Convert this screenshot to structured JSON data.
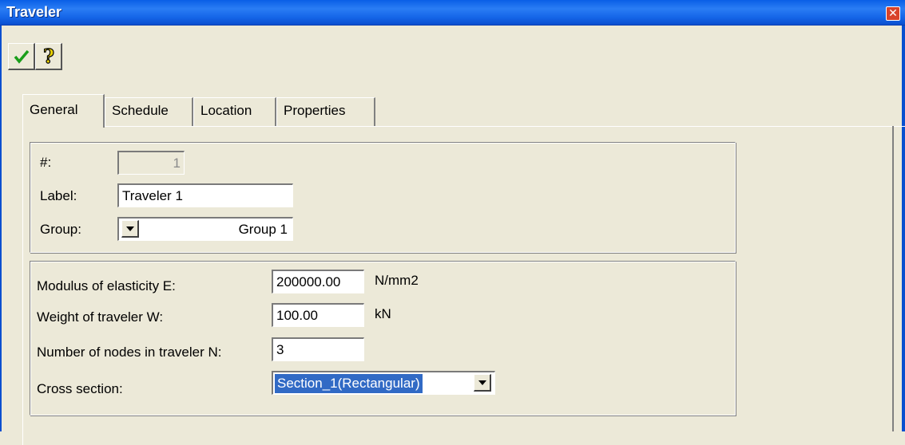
{
  "window": {
    "title": "Traveler"
  },
  "icons": {
    "close": "close-icon",
    "ok": "checkmark-icon",
    "help": "help-icon",
    "dropdown": "chevron-down-icon"
  },
  "tabs": [
    {
      "label": "General",
      "active": true
    },
    {
      "label": "Schedule",
      "active": false
    },
    {
      "label": "Location",
      "active": false
    },
    {
      "label": "Properties",
      "active": false
    }
  ],
  "general": {
    "number_label": "#:",
    "number_value": "1",
    "label_label": "Label:",
    "label_value": "Traveler 1",
    "group_label": "Group:",
    "group_value": "Group 1"
  },
  "properties": {
    "modulus_label": "Modulus of elasticity E:",
    "modulus_value": "200000.00",
    "modulus_unit": "N/mm2",
    "weight_label": "Weight of traveler W:",
    "weight_value": "100.00",
    "weight_unit": "kN",
    "nodes_label": "Number of nodes in traveler N:",
    "nodes_value": "3",
    "cross_section_label": "Cross section:",
    "cross_section_value": "Section_1(Rectangular)"
  },
  "colors": {
    "titlebar": "#0a5fe6",
    "selection": "#316ac5",
    "window_bg": "#ece9d8"
  }
}
